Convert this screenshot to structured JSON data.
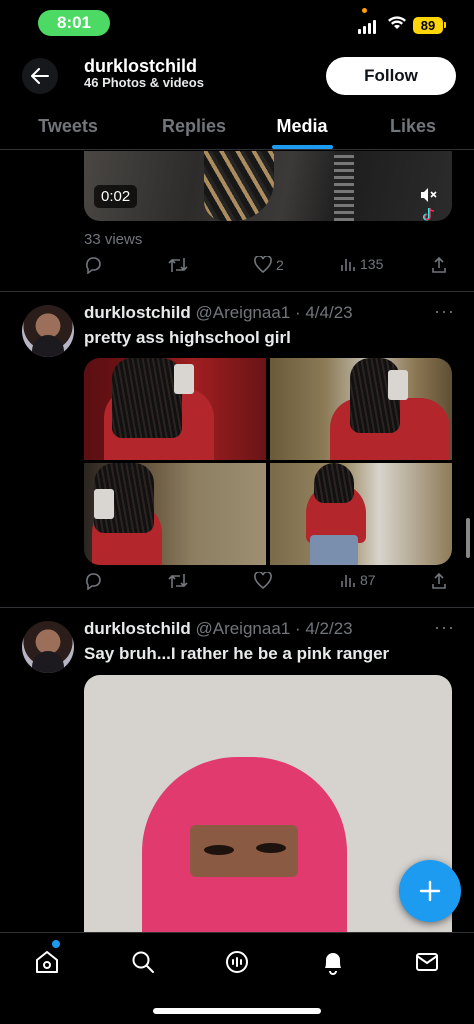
{
  "status_bar": {
    "time": "8:01",
    "battery": "89"
  },
  "header": {
    "back_icon": "arrow-left-icon",
    "name": "durklostchild",
    "subtitle": "46 Photos & videos",
    "follow_label": "Follow"
  },
  "tabs": [
    {
      "label": "Tweets",
      "active": false
    },
    {
      "label": "Replies",
      "active": false
    },
    {
      "label": "Media",
      "active": true
    },
    {
      "label": "Likes",
      "active": false
    }
  ],
  "video_tweet": {
    "duration": "0:02",
    "views": "33 views",
    "likes": "2",
    "analytics": "135"
  },
  "tweets": [
    {
      "name": "durklostchild",
      "handle": "@Areignaa1 · 4/4/23",
      "text": "pretty ass highschool girl",
      "analytics": "87"
    },
    {
      "name": "durklostchild",
      "handle": "@Areignaa1 · 4/2/23",
      "text": "Say bruh...I rather he be a pink ranger"
    }
  ],
  "more_label": "···",
  "colors": {
    "accent": "#1d9bf0",
    "background": "#000000",
    "muted": "#71767b",
    "status_green": "#4cd964",
    "battery_yellow": "#ffd60a"
  },
  "nav": [
    "home-icon",
    "search-icon",
    "spaces-icon",
    "notifications-icon",
    "messages-icon"
  ]
}
